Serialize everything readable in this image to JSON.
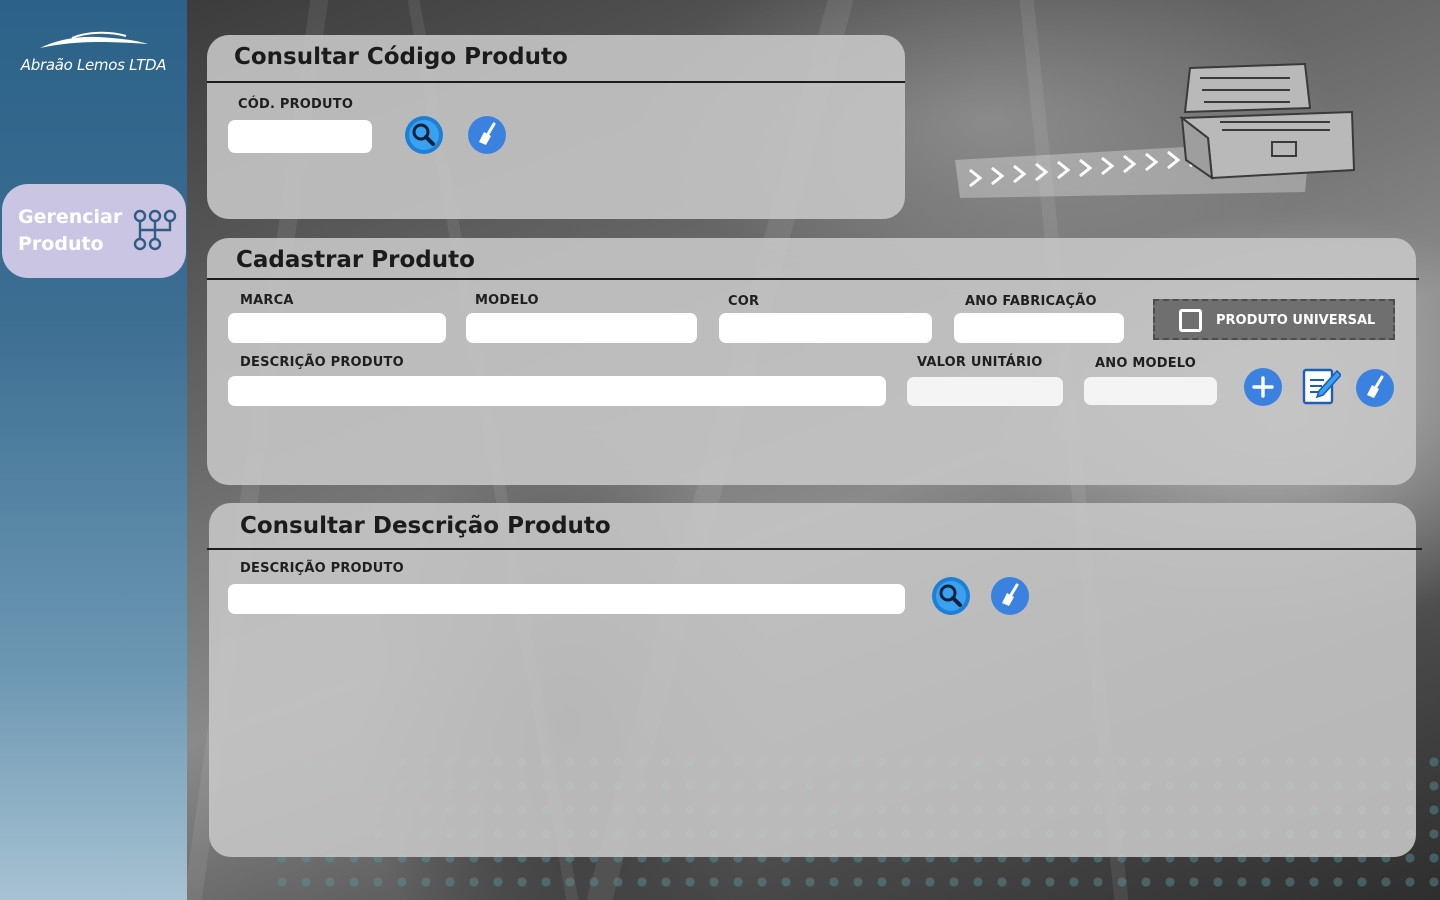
{
  "app": {
    "company_name": "Abraão Lemos LTDA",
    "colors": {
      "sidebar_top": "#2c6289",
      "sidebar_bottom": "#a7c2d2",
      "nav_active_bg": "#c9c5e2",
      "button_blue": "#3b82e0",
      "search_blue": "#1f7fd6"
    }
  },
  "sidebar": {
    "items": [
      {
        "label": "Gerenciar Produto",
        "icon": "branch-network-icon",
        "active": true
      }
    ]
  },
  "consult_code": {
    "title": "Consultar Código Produto",
    "code_label": "CÓD. PRODUTO",
    "code_value": "",
    "search_icon": "search-icon",
    "clear_icon": "broom-icon"
  },
  "register": {
    "title": "Cadastrar Produto",
    "brand_label": "MARCA",
    "brand_value": "",
    "model_label": "MODELO",
    "model_value": "",
    "color_label": "COR",
    "color_value": "",
    "year_made_label": "ANO FABRICAÇÃO",
    "year_made_value": "",
    "universal_label": "PRODUTO UNIVERSAL",
    "universal_checked": false,
    "description_label": "DESCRIÇÃO PRODUTO",
    "description_value": "",
    "unit_price_label": "VALOR UNITÁRIO",
    "unit_price_value": "",
    "model_year_label": "ANO MODELO",
    "model_year_value": "",
    "add_icon": "plus-icon",
    "edit_icon": "edit-icon",
    "clear_icon": "broom-icon"
  },
  "consult_desc": {
    "title": "Consultar Descrição Produto",
    "description_label": "DESCRIÇÃO PRODUTO",
    "description_value": "",
    "search_icon": "search-icon",
    "clear_icon": "broom-icon"
  },
  "decoration": {
    "header_art": "toolbox-tire-track-illustration"
  }
}
